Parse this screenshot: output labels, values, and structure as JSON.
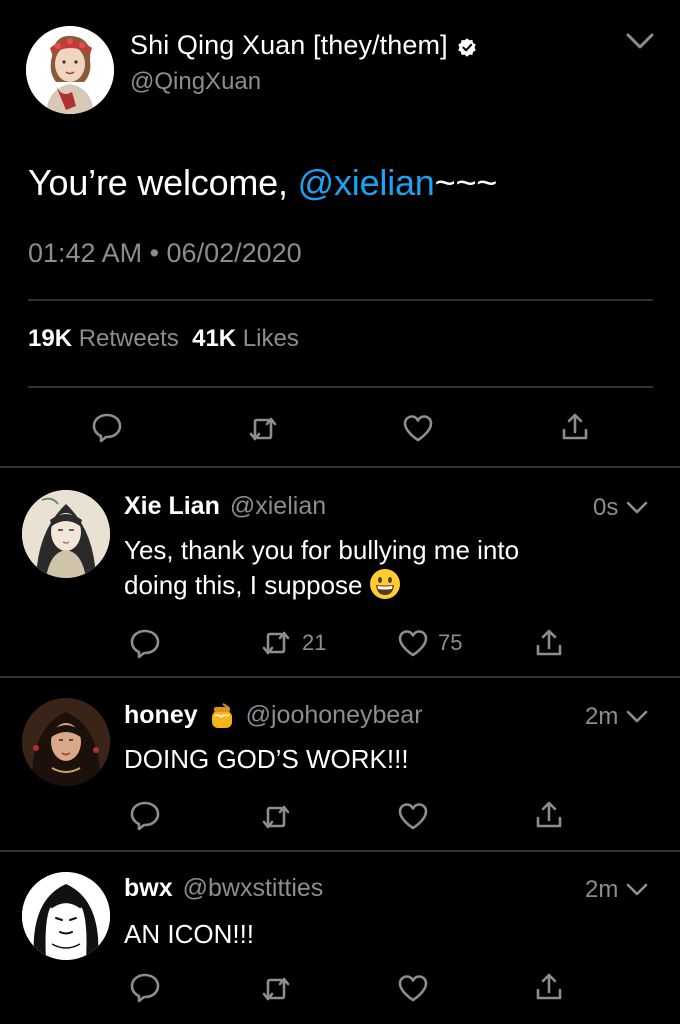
{
  "main_tweet": {
    "display_name": "Shi Qing Xuan [they/them]",
    "handle": "@QingXuan",
    "text_prefix": "You’re welcome, ",
    "mention": "@xielian",
    "text_suffix": "~~~",
    "timestamp": "01:42 AM • 06/02/2020",
    "retweets_count": "19K",
    "retweets_label": "Retweets",
    "likes_count": "41K",
    "likes_label": "Likes"
  },
  "replies": [
    {
      "display_name": "Xie Lian",
      "handle": "@xielian",
      "time": "0s",
      "text_line1": "Yes, thank you for bullying me into",
      "text_line2": "doing this, I suppose",
      "retweets": "21",
      "likes": "75"
    },
    {
      "display_name": "honey",
      "handle": "@joohoneybear",
      "time": "2m",
      "text": "DOING GOD’S WORK!!!"
    },
    {
      "display_name": "bwx",
      "handle": "@bwxstitties",
      "time": "2m",
      "text": "AN ICON!!!"
    }
  ],
  "colors": {
    "background": "#000000",
    "accent": "#1da1f2",
    "secondary_text": "#8a8d91",
    "divider": "#2f3336"
  },
  "icons": [
    "verified-icon",
    "chevron-down-icon",
    "reply-icon",
    "retweet-icon",
    "like-icon",
    "share-icon",
    "grinning-emoji",
    "honey-pot-emoji"
  ]
}
